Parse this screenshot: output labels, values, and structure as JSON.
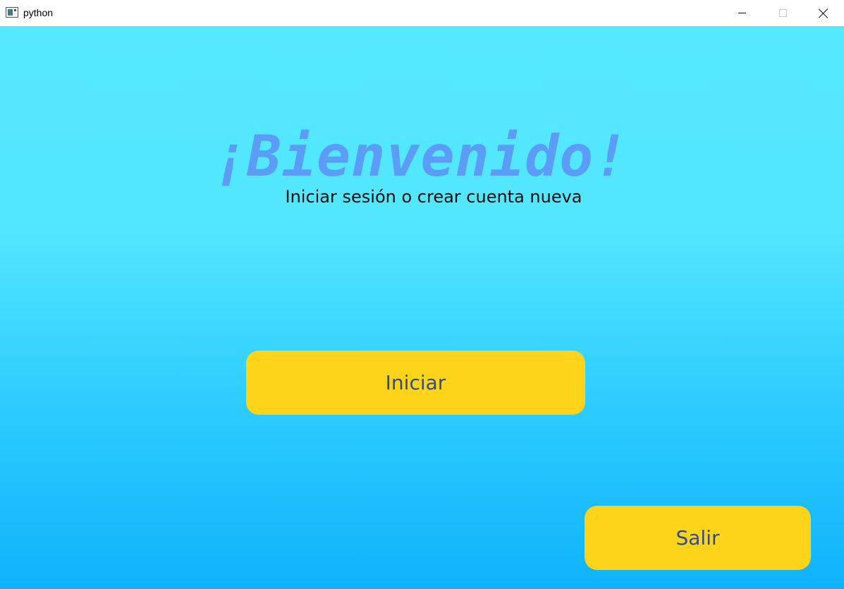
{
  "window": {
    "title": "python",
    "icon": "app-window-icon",
    "controls": [
      "minimize-icon",
      "maximize-icon",
      "close-icon"
    ]
  },
  "main": {
    "heading": "¡Bienvenido!",
    "subtitle": "Iniciar sesión o crear cuenta nueva",
    "start_button": "Iniciar",
    "exit_button": "Salir"
  },
  "colors": {
    "background_top": "#55e8ff",
    "background_bottom": "#10b2fb",
    "heading": "#5b9cf6",
    "button_bg": "#fdd419",
    "button_text": "#2f4c8e"
  }
}
